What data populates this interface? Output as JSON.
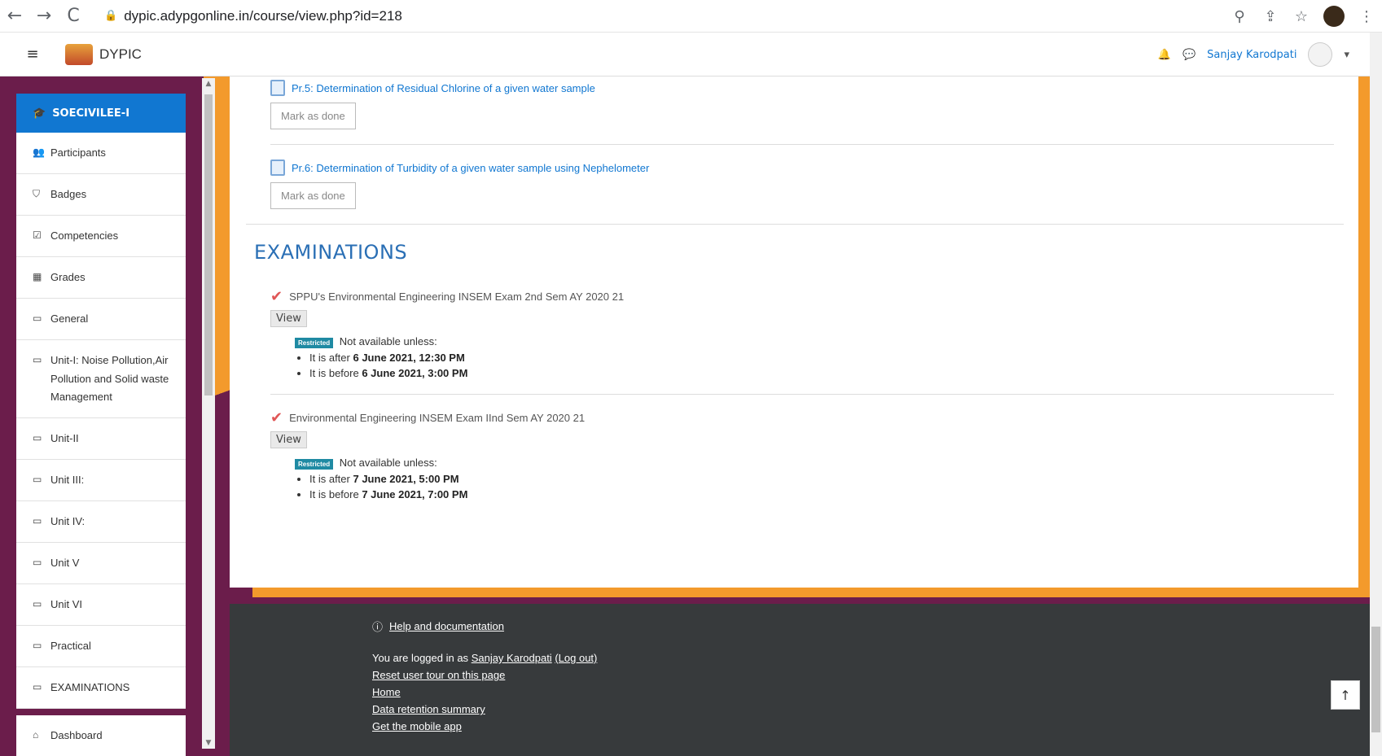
{
  "browser": {
    "back_icon": "←",
    "forward_icon": "→",
    "reload_icon": "C",
    "url": "dypic.adypgonline.in/course/view.php?id=218",
    "zoom_icon": "⚲",
    "share_icon": "⇪",
    "star_icon": "☆",
    "menu_icon": "⋮"
  },
  "navbar": {
    "brand": "DYPIC",
    "hamburger": "≡",
    "bell": "🔔",
    "message": "💬",
    "user": "Sanjay Karodpati",
    "caret": "▾"
  },
  "sidebar": {
    "course": "SOECIVILEE-I",
    "items": [
      {
        "icon": "👥",
        "label": "Participants"
      },
      {
        "icon": "⛉",
        "label": "Badges"
      },
      {
        "icon": "☑",
        "label": "Competencies"
      },
      {
        "icon": "▦",
        "label": "Grades"
      },
      {
        "icon": "▭",
        "label": "General"
      },
      {
        "icon": "▭",
        "label": "Unit-I: Noise Pollution,Air Pollution and Solid waste Management"
      },
      {
        "icon": "▭",
        "label": "Unit-II"
      },
      {
        "icon": "▭",
        "label": "Unit III:"
      },
      {
        "icon": "▭",
        "label": "Unit IV:"
      },
      {
        "icon": "▭",
        "label": "Unit V"
      },
      {
        "icon": "▭",
        "label": "Unit VI"
      },
      {
        "icon": "▭",
        "label": "Practical"
      },
      {
        "icon": "▭",
        "label": "EXAMINATIONS"
      }
    ],
    "dashboard": {
      "icon": "⌂",
      "label": "Dashboard"
    }
  },
  "main": {
    "activities": [
      {
        "title": "Pr.5: Determination of Residual Chlorine of a given water sample",
        "button": "Mark as done"
      },
      {
        "title": "Pr.6: Determination of Turbidity of a given water sample using Nephelometer",
        "button": "Mark as done"
      }
    ],
    "section_title": "EXAMINATIONS",
    "quizzes": [
      {
        "title": "SPPU's Environmental Engineering INSEM Exam 2nd Sem AY 2020 21",
        "view": "View",
        "badge": "Restricted",
        "restrict_text": "Not available unless:",
        "after_label": "It is after",
        "after": "6 June 2021, 12:30 PM",
        "before_label": "It is before",
        "before": "6 June 2021, 3:00 PM"
      },
      {
        "title": "Environmental Engineering INSEM Exam IInd Sem AY 2020 21",
        "view": "View",
        "badge": "Restricted",
        "restrict_text": "Not available unless:",
        "after_label": "It is after",
        "after": "7 June 2021, 5:00 PM",
        "before_label": "It is before",
        "before": "7 June 2021, 7:00 PM"
      }
    ]
  },
  "footer": {
    "help": "Help and documentation",
    "logged_prefix": "You are logged in as",
    "user": "Sanjay Karodpati",
    "logout": "(Log out)",
    "reset_tour": "Reset user tour on this page",
    "home": "Home",
    "data_retention": "Data retention summary",
    "mobile_app": "Get the mobile app",
    "top_icon": "↑"
  }
}
